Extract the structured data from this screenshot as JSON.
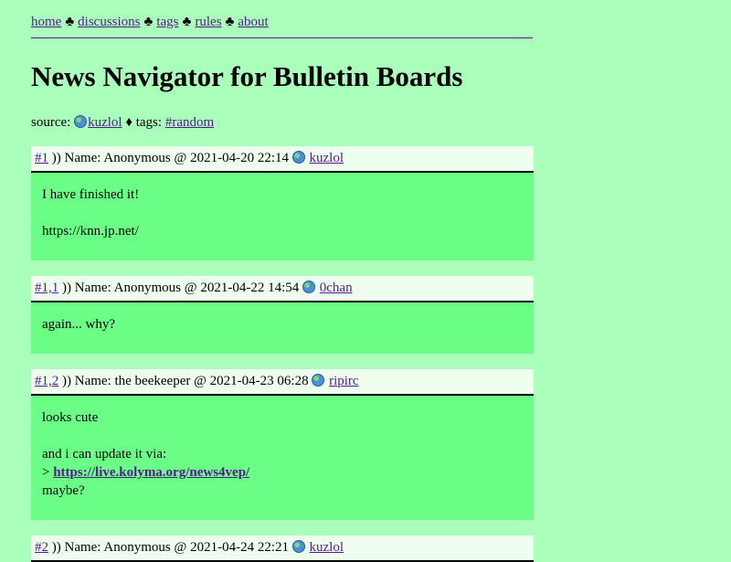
{
  "nav": {
    "items": [
      "home",
      "discussions",
      "tags",
      "rules",
      "about"
    ],
    "separator": "♣"
  },
  "page_title": "News Navigator for Bulletin Boards",
  "source": {
    "label": "source:",
    "site": "kuzlol",
    "tags_sep": "♦",
    "tags_label": "tags:",
    "tag": "#random"
  },
  "posts": [
    {
      "num": "#1",
      "marker": ")) Name:",
      "name": "Anonymous",
      "at": "@",
      "datetime": "2021-04-20 22:14",
      "site": "kuzlol",
      "lines": [
        "I have finished it!",
        "",
        "https://knn.jp.net/"
      ]
    },
    {
      "num": "#1,1",
      "marker": ")) Name:",
      "name": "Anonymous",
      "at": "@",
      "datetime": "2021-04-22 14:54",
      "site": "0chan",
      "lines": [
        "again... why?"
      ]
    },
    {
      "num": "#1,2",
      "marker": ")) Name:",
      "name": "the beekeeper",
      "at": "@",
      "datetime": "2021-04-23 06:28",
      "site": "ripirc",
      "lines_a": [
        "looks cute",
        "",
        "and i can update it via:"
      ],
      "quote_gt": ">",
      "quote_link": "https://live.kolyma.org/news4vep/",
      "lines_b": [
        "maybe?"
      ]
    },
    {
      "num": "#2",
      "marker": ")) Name:",
      "name": "Anonymous",
      "at": "@",
      "datetime": "2021-04-24 22:21",
      "site": "kuzlol"
    }
  ]
}
